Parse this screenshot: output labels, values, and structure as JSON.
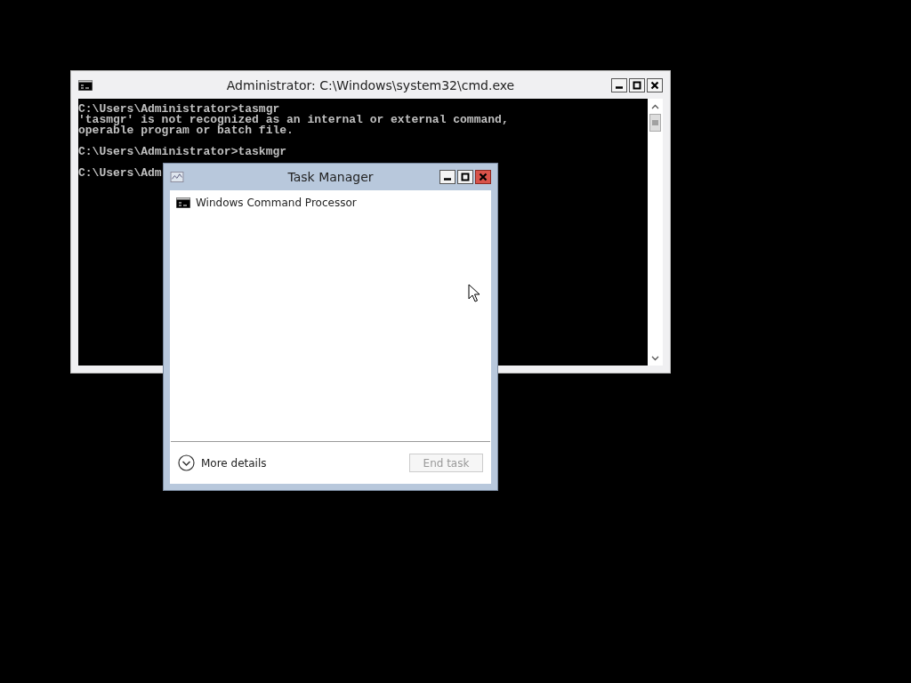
{
  "console_window": {
    "title": "Administrator: C:\\Windows\\system32\\cmd.exe",
    "blocks": [
      [
        "C:\\Users\\Administrator>tasmgr",
        "'tasmgr' is not recognized as an internal or external command,",
        "operable program or batch file."
      ],
      [
        "C:\\Users\\Administrator>taskmgr"
      ],
      [
        "C:\\Users\\Adm"
      ]
    ]
  },
  "task_manager": {
    "title": "Task Manager",
    "apps": [
      {
        "name": "Windows Command Processor"
      }
    ],
    "more_details": "More details",
    "end_task": {
      "label": "End task",
      "disabled": true
    }
  }
}
